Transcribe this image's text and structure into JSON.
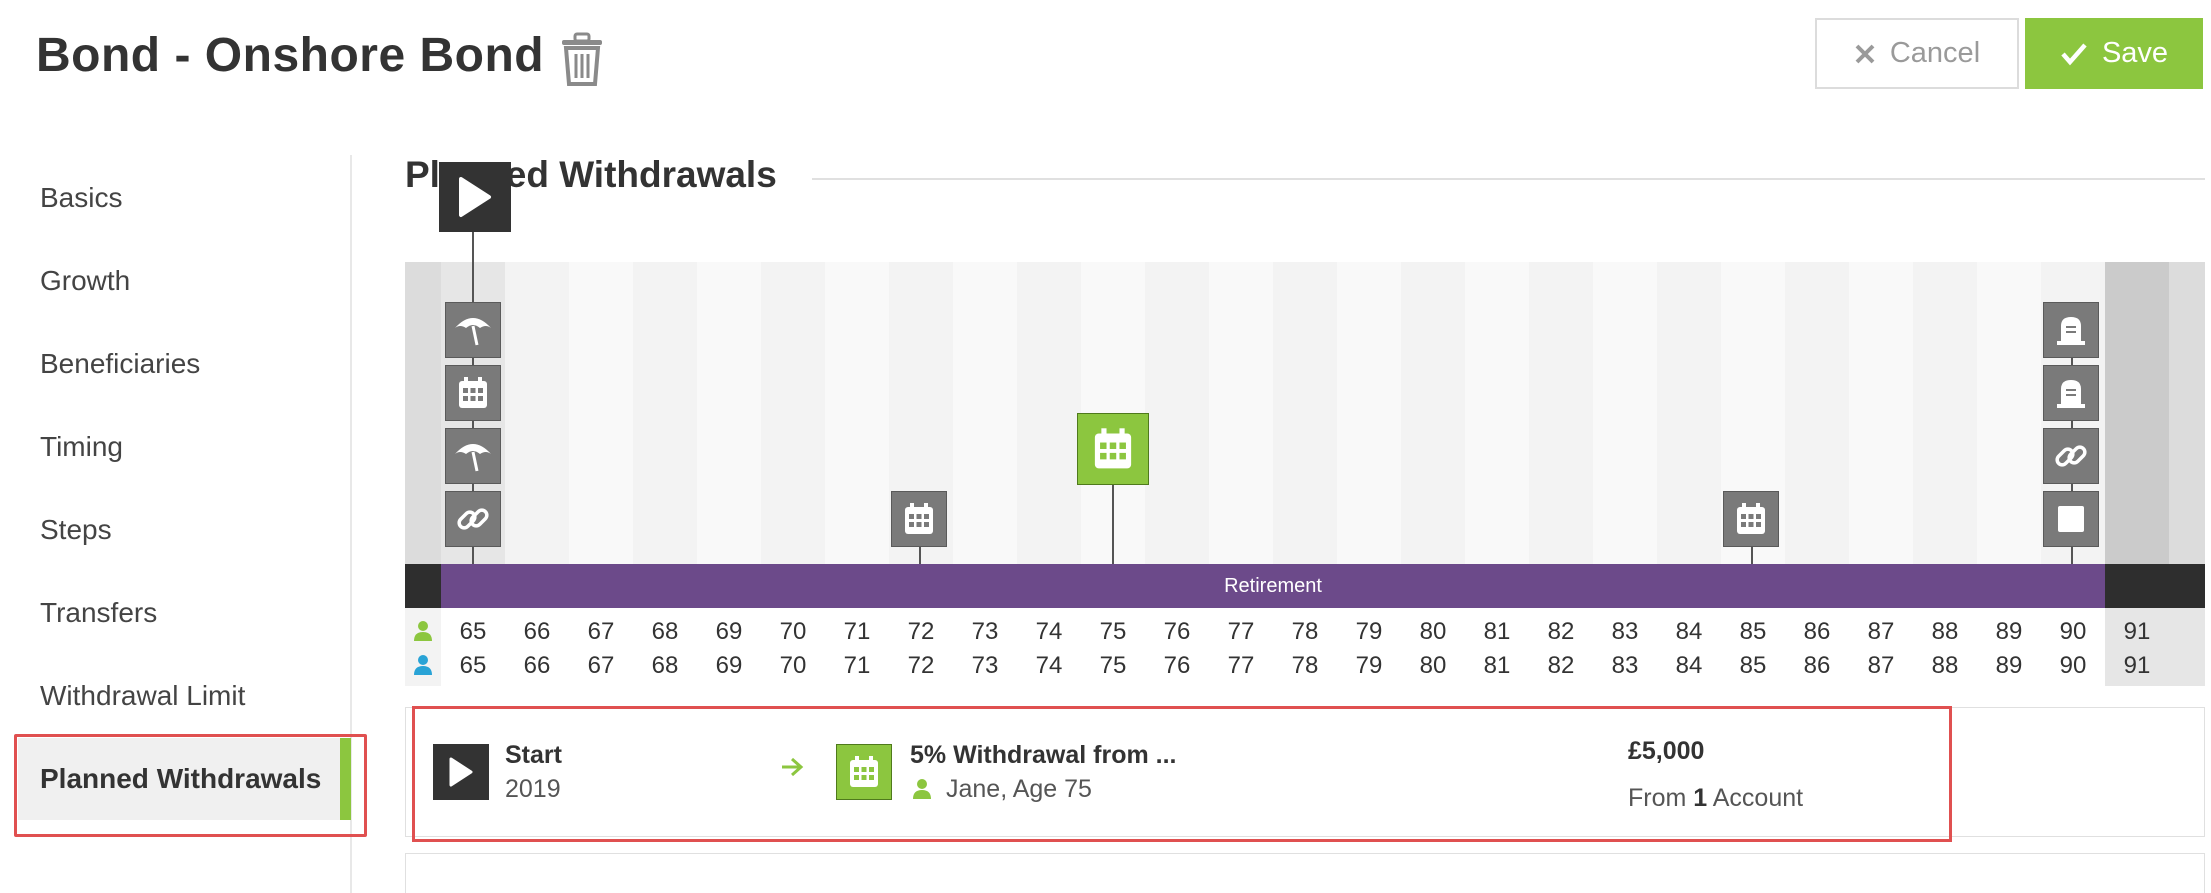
{
  "header": {
    "title": "Bond - Onshore Bond",
    "cancel_label": "Cancel",
    "save_label": "Save"
  },
  "sidebar": {
    "items": [
      {
        "label": "Basics"
      },
      {
        "label": "Growth"
      },
      {
        "label": "Beneficiaries"
      },
      {
        "label": "Timing"
      },
      {
        "label": "Steps"
      },
      {
        "label": "Transfers"
      },
      {
        "label": "Withdrawal Limit"
      },
      {
        "label": "Planned Withdrawals"
      }
    ],
    "active": "Planned Withdrawals"
  },
  "section": {
    "title": "Planned Withdrawals"
  },
  "timeline": {
    "band_label": "Retirement",
    "ages_person1": [
      "65",
      "66",
      "67",
      "68",
      "69",
      "70",
      "71",
      "72",
      "73",
      "74",
      "75",
      "76",
      "77",
      "78",
      "79",
      "80",
      "81",
      "82",
      "83",
      "84",
      "85",
      "86",
      "87",
      "88",
      "89",
      "90",
      "91"
    ],
    "ages_person2": [
      "65",
      "66",
      "67",
      "68",
      "69",
      "70",
      "71",
      "72",
      "73",
      "74",
      "75",
      "76",
      "77",
      "78",
      "79",
      "80",
      "81",
      "82",
      "83",
      "84",
      "85",
      "86",
      "87",
      "88",
      "89",
      "90",
      "91"
    ],
    "events": [
      "play-icon",
      "umbrella-icon",
      "calendar-icon",
      "umbrella-icon",
      "link-icon",
      "calendar-icon",
      "calendar-icon",
      "calendar-icon",
      "tombstone-icon",
      "tombstone-icon",
      "link-icon",
      "square-icon"
    ]
  },
  "withdrawal": {
    "start_label": "Start",
    "start_year": "2019",
    "name": "5% Withdrawal from ...",
    "person": "Jane, Age 75",
    "amount": "£5,000",
    "from_prefix": "From ",
    "from_count": "1",
    "from_suffix": " Account"
  },
  "colors": {
    "accent_green": "#8cc63f",
    "retirement_purple": "#6c4a8a",
    "highlight_red": "#e05050",
    "person1": "#8cc63f",
    "person2": "#29a3d6"
  }
}
